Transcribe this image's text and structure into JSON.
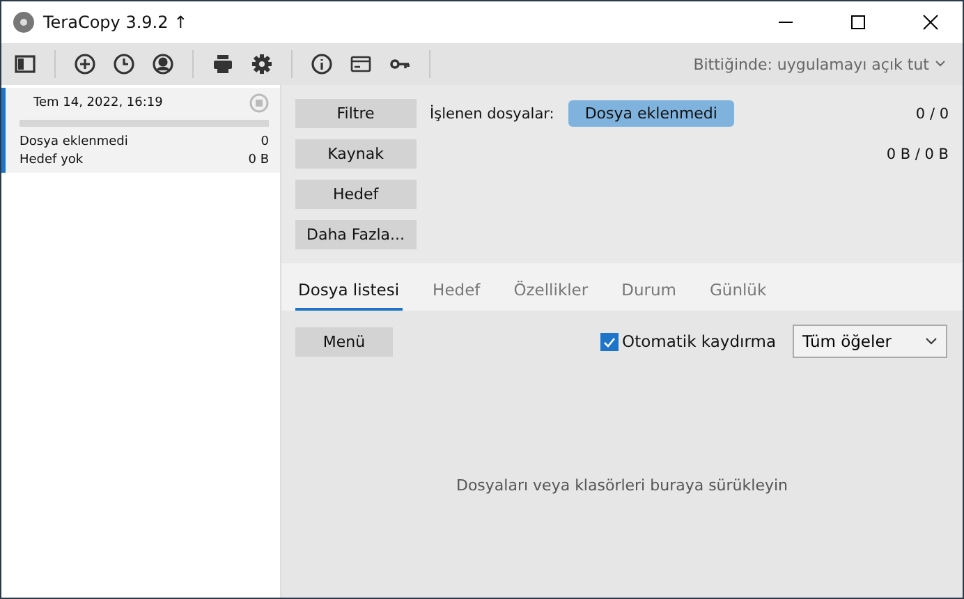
{
  "window": {
    "title": "TeraCopy 3.9.2 ↑"
  },
  "toolbar": {
    "on_finish": "Bittiğinde: uygulamayı açık tut"
  },
  "jobs": [
    {
      "date": "Tem 14, 2022, 16:19",
      "selected": true,
      "files_label": "Dosya eklenmedi",
      "files_count": "0",
      "target_label": "Hedef yok",
      "target_size": "0 B"
    }
  ],
  "actions": [
    "Filtre",
    "Kaynak",
    "Hedef",
    "Daha Fazla..."
  ],
  "processed": {
    "label": "İşlenen dosyalar:",
    "status": "Dosya eklenmedi",
    "count": "0 / 0",
    "size": "0 B / 0 B"
  },
  "tabs": [
    {
      "label": "Dosya listesi",
      "selected": true
    },
    {
      "label": "Hedef",
      "selected": false
    },
    {
      "label": "Özellikler",
      "selected": false
    },
    {
      "label": "Durum",
      "selected": false
    },
    {
      "label": "Günlük",
      "selected": false
    }
  ],
  "list": {
    "menu": "Menü",
    "autoscroll": {
      "label": "Otomatik kaydırma",
      "checked": true
    },
    "filter": "Tüm öğeler",
    "empty": "Dosyaları veya klasörleri buraya sürükleyin"
  }
}
